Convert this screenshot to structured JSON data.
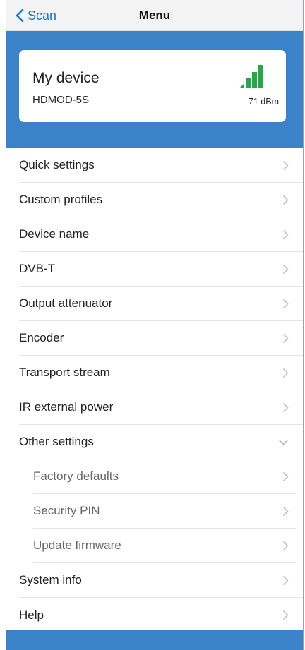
{
  "navbar": {
    "back_label": "Scan",
    "title": "Menu"
  },
  "device": {
    "name": "My device",
    "model": "HDMOD-5S",
    "signal_dbm": "-71 dBm",
    "signal_color": "#27a64a"
  },
  "menu": {
    "items": [
      {
        "label": "Quick settings",
        "icon": "chevron-right-icon"
      },
      {
        "label": "Custom profiles",
        "icon": "chevron-right-icon"
      },
      {
        "label": "Device name",
        "icon": "chevron-right-icon"
      },
      {
        "label": "DVB-T",
        "icon": "chevron-right-icon"
      },
      {
        "label": "Output attenuator",
        "icon": "chevron-right-icon"
      },
      {
        "label": "Encoder",
        "icon": "chevron-right-icon"
      },
      {
        "label": "Transport stream",
        "icon": "chevron-right-icon"
      },
      {
        "label": "IR external power",
        "icon": "chevron-right-icon"
      },
      {
        "label": "Other settings",
        "icon": "chevron-down-icon",
        "expanded": true
      }
    ],
    "sub_items": [
      {
        "label": "Factory defaults",
        "icon": "chevron-right-icon"
      },
      {
        "label": "Security PIN",
        "icon": "chevron-right-icon"
      },
      {
        "label": "Update firmware",
        "icon": "chevron-right-icon"
      }
    ],
    "tail_items": [
      {
        "label": "System info",
        "icon": "chevron-right-icon"
      },
      {
        "label": "Help",
        "icon": "chevron-right-icon"
      }
    ]
  },
  "colors": {
    "accent": "#3b83c9",
    "link": "#1677d2",
    "chevron": "#b5b5b5"
  }
}
